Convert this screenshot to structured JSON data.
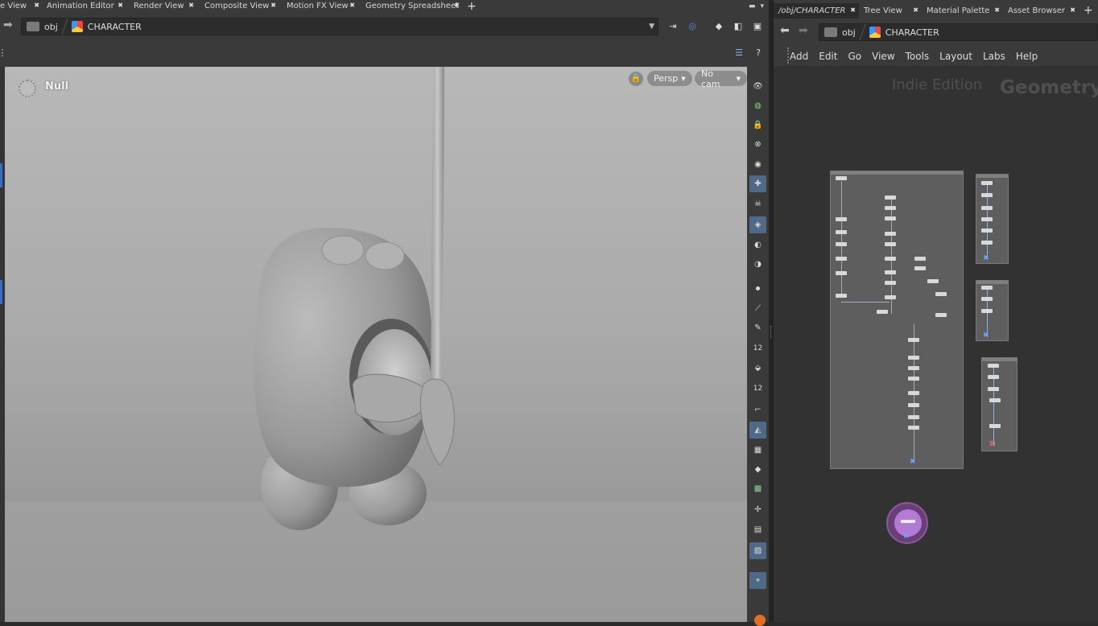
{
  "left_pane": {
    "tabs": [
      {
        "label": "e View"
      },
      {
        "label": "Animation Editor"
      },
      {
        "label": "Render View"
      },
      {
        "label": "Composite View"
      },
      {
        "label": "Motion FX View"
      },
      {
        "label": "Geometry Spreadsheet"
      }
    ],
    "path": {
      "root": "obj",
      "current": "CHARACTER"
    },
    "viewport": {
      "selected_label": "Null",
      "camera_view": "Persp",
      "camera": "No cam"
    },
    "side_tool_badges": {
      "snap_count_a": "12",
      "snap_count_b": "12"
    }
  },
  "right_pane": {
    "tabs": [
      {
        "label": "/obj/CHARACTER",
        "active": true
      },
      {
        "label": "Tree View"
      },
      {
        "label": "Material Palette"
      },
      {
        "label": "Asset Browser"
      }
    ],
    "path": {
      "root": "obj",
      "current": "CHARACTER"
    },
    "menu": [
      "Add",
      "Edit",
      "Go",
      "View",
      "Tools",
      "Layout",
      "Labs",
      "Help"
    ],
    "watermark": {
      "edition": "Indie Edition",
      "context": "Geometry"
    }
  },
  "colors": {
    "accent_blue": "#4f6a88",
    "network_bg": "#323232",
    "panel_bg": "#3a3a3a",
    "controller_purple": "#b27bd6",
    "warning": "#e07020"
  }
}
